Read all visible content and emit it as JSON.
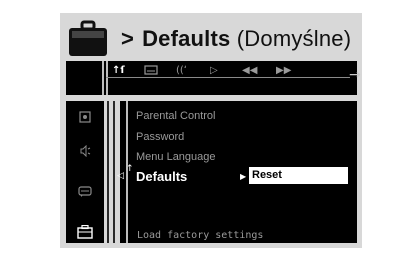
{
  "header": {
    "prefix": ">",
    "title": "Defaults",
    "subtitle": "(Domyślne)",
    "icon": "briefcase-icon"
  },
  "toolbar": {
    "icons": [
      "settings-adjust-icon",
      "subtitle-icon",
      "audio-icon",
      "play-icon",
      "rewind-icon",
      "fast-forward-icon"
    ],
    "active_glyph": "↑ſ",
    "arrow": "→"
  },
  "sidebar": {
    "icons": [
      "disc-icon",
      "speaker-icon",
      "subtitle-icon",
      "briefcase-icon"
    ],
    "selected": "briefcase-icon"
  },
  "menu": {
    "items": [
      {
        "label": "Parental Control"
      },
      {
        "label": "Password"
      },
      {
        "label": "Menu Language"
      },
      {
        "label": "Defaults"
      }
    ],
    "selected_index": 3,
    "option_label": "Reset",
    "status": "Load factory settings"
  },
  "colors": {
    "panel": "#d8d8d8",
    "screen": "#000000",
    "highlight": "#ffffff",
    "dim_text": "#9a9a9a"
  }
}
